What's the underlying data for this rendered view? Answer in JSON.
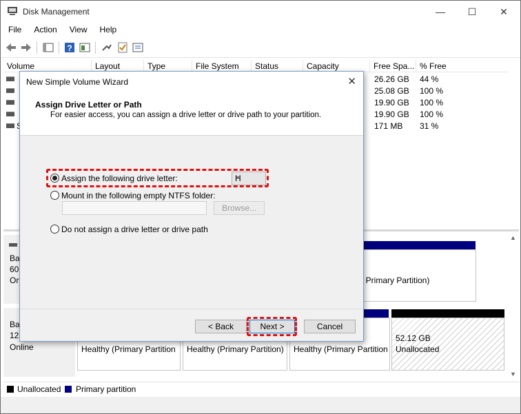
{
  "window": {
    "title": "Disk Management",
    "minimize": "—",
    "maximize": "☐",
    "close": "✕"
  },
  "menu": [
    "File",
    "Action",
    "View",
    "Help"
  ],
  "volume_table": {
    "columns": [
      "Volume",
      "Layout",
      "Type",
      "File System",
      "Status",
      "Capacity",
      "Free Spa...",
      "% Free"
    ],
    "rows": [
      {
        "volume": "",
        "free": "26.26 GB",
        "pct": "44 %"
      },
      {
        "volume": "",
        "free": "25.08 GB",
        "pct": "100 %"
      },
      {
        "volume": "",
        "free": "19.90 GB",
        "pct": "100 %"
      },
      {
        "volume": "",
        "free": "19.90 GB",
        "pct": "100 %"
      },
      {
        "volume": "S",
        "free": "171 MB",
        "pct": "31 %"
      }
    ]
  },
  "disks": [
    {
      "label_line1": "Ba",
      "label_line2": "60.",
      "label_line3": "Onl"
    },
    {
      "label_line1": "Ba",
      "label_line2": "128",
      "label_line3": "Online"
    }
  ],
  "disk0_partition_right": ", Primary Partition)",
  "disk1_partitions": [
    {
      "text": "Healthy (Primary Partition"
    },
    {
      "text": "Healthy (Primary Partition)"
    },
    {
      "text": "Healthy (Primary Partition"
    }
  ],
  "unallocated": {
    "size": "52.12 GB",
    "label": "Unallocated"
  },
  "legend": [
    {
      "label": "Unallocated",
      "color": "#000000"
    },
    {
      "label": "Primary partition",
      "color": "#00007f"
    }
  ],
  "wizard": {
    "title": "New Simple Volume Wizard",
    "close": "✕",
    "heading": "Assign Drive Letter or Path",
    "subheading": "For easier access, you can assign a drive letter or drive path to your partition.",
    "options": [
      {
        "label": "Assign the following drive letter:",
        "selected": true
      },
      {
        "label": "Mount in the following empty NTFS folder:",
        "selected": false
      },
      {
        "label": "Do not assign a drive letter or drive path",
        "selected": false
      }
    ],
    "drive_letter": "H",
    "browse": "Browse...",
    "back": "< Back",
    "next": "Next >",
    "cancel": "Cancel"
  },
  "colors": {
    "highlight": "#e01010",
    "primary_partition": "#00007f"
  }
}
